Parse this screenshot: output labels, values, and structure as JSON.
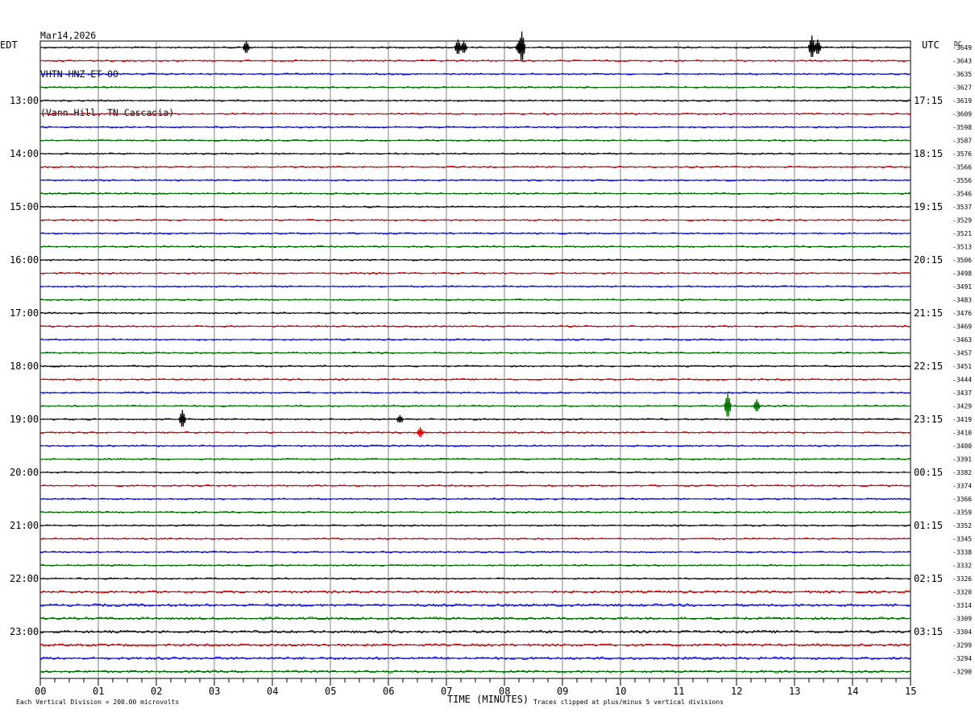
{
  "header": {
    "date": "Mar14,2026",
    "channel": "VHTN HNZ ET 00",
    "station": "(Vann Hill, TN Cascadia)"
  },
  "left_tz": "EDT",
  "right_tz": "UTC",
  "dc_label": "DC",
  "trace_colors": [
    "#000000",
    "#e00000",
    "#0000e0",
    "#007000"
  ],
  "chart_data": {
    "type": "line",
    "title": "VHTN HNZ ET 00",
    "xlabel": "TIME (MINUTES)",
    "x_ticks": [
      "00",
      "01",
      "02",
      "03",
      "04",
      "05",
      "06",
      "07",
      "08",
      "09",
      "10",
      "11",
      "12",
      "13",
      "14",
      "15"
    ],
    "xlim": [
      0,
      15
    ],
    "rows_per_hour": 4,
    "row_count": 48,
    "left_hour_labels": [
      "13:00",
      "14:00",
      "15:00",
      "16:00",
      "17:00",
      "18:00",
      "19:00",
      "20:00",
      "21:00",
      "22:00",
      "23:00"
    ],
    "right_hour_labels": [
      "17:15",
      "18:15",
      "19:15",
      "20:15",
      "21:15",
      "22:15",
      "23:15",
      "00:15",
      "01:15",
      "02:15",
      "03:15"
    ],
    "dc_offsets": [
      -3649,
      -3643,
      -3635,
      -3627,
      -3619,
      -3609,
      -3598,
      -3587,
      -3576,
      -3566,
      -3556,
      -3546,
      -3537,
      -3529,
      -3521,
      -3513,
      -3506,
      -3498,
      -3491,
      -3483,
      -3476,
      -3469,
      -3463,
      -3457,
      -3451,
      -3444,
      -3437,
      -3429,
      -3419,
      -3410,
      -3400,
      -3391,
      -3382,
      -3374,
      -3366,
      -3359,
      -3352,
      -3345,
      -3338,
      -3332,
      -3326,
      -3320,
      -3314,
      -3309,
      -3304,
      -3299,
      -3294,
      -3290
    ],
    "events": [
      {
        "row": 0,
        "minute": 3.55,
        "amp": 0.5
      },
      {
        "row": 0,
        "minute": 7.2,
        "amp": 0.6
      },
      {
        "row": 0,
        "minute": 7.3,
        "amp": 0.5
      },
      {
        "row": 0,
        "minute": 8.25,
        "amp": 0.5
      },
      {
        "row": 0,
        "minute": 8.3,
        "amp": 1.2
      },
      {
        "row": 0,
        "minute": 13.3,
        "amp": 0.9
      },
      {
        "row": 0,
        "minute": 13.4,
        "amp": 0.6
      },
      {
        "row": 27,
        "minute": 11.85,
        "amp": 1.0
      },
      {
        "row": 27,
        "minute": 12.35,
        "amp": 0.5
      },
      {
        "row": 28,
        "minute": 2.45,
        "amp": 0.7
      },
      {
        "row": 28,
        "minute": 6.2,
        "amp": 0.3
      },
      {
        "row": 29,
        "minute": 6.55,
        "amp": 0.4
      }
    ],
    "scale_text": "Each Vertical Division =  200.00 microvolts",
    "clip_text": "Traces clipped at plus/minus 5 vertical divisions"
  }
}
